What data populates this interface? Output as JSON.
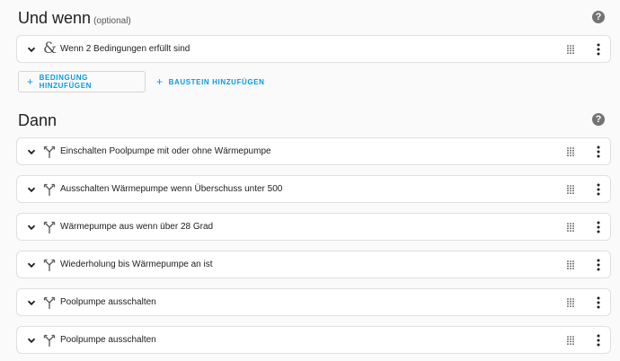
{
  "conditions_section": {
    "title": "Und wenn",
    "optional": "(optional)",
    "help_icon": "help-circle-icon",
    "item": {
      "label": "Wenn 2 Bedingungen erfüllt sind",
      "icon": "ampersand-icon"
    },
    "add_condition_label": "BEDINGUNG HINZUFÜGEN",
    "add_block_label": "BAUSTEIN HINZUFÜGEN",
    "plus": "+"
  },
  "actions_section": {
    "title": "Dann",
    "help_icon": "help-circle-icon",
    "items": [
      {
        "label": "Einschalten Poolpumpe mit oder ohne Wärmepumpe",
        "icon": "call-split-icon"
      },
      {
        "label": "Ausschalten Wärmepumpe wenn Überschuss unter 500",
        "icon": "call-split-icon"
      },
      {
        "label": "Wärmepumpe aus wenn über 28 Grad",
        "icon": "call-split-icon"
      },
      {
        "label": "Wiederholung bis Wärmepumpe an ist",
        "icon": "call-split-icon"
      },
      {
        "label": "Poolpumpe ausschalten",
        "icon": "call-split-icon"
      },
      {
        "label": "Poolpumpe ausschalten",
        "icon": "call-split-icon"
      }
    ]
  },
  "colors": {
    "accent": "#039be5",
    "background": "#fafafa",
    "card": "#ffffff",
    "border": "#e0e0e0"
  }
}
